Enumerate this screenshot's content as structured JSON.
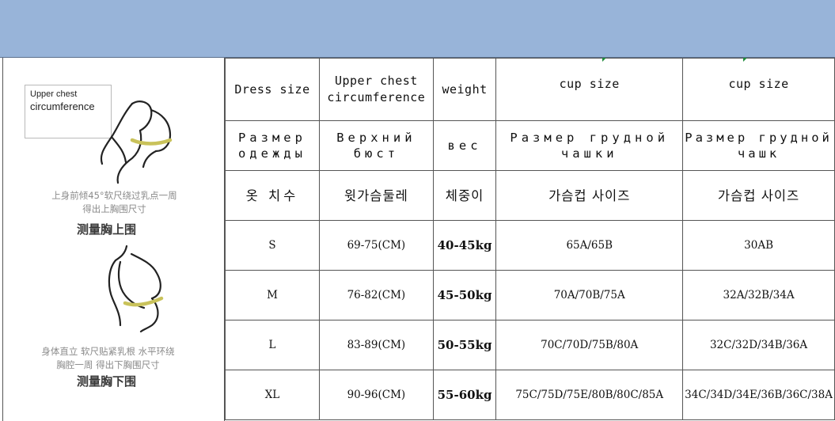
{
  "header_band": {
    "color": "#98b4d9"
  },
  "left_panel": {
    "callout": {
      "line1": "Upper chest",
      "line2": "circumference"
    },
    "upper_caption": {
      "line1": "上身前倾45°软尺绕过乳点一周",
      "line2": "得出上胸围尺寸",
      "title": "测量胸上围"
    },
    "lower_caption": {
      "line1": "身体直立 软尺贴紧乳根 水平环绕",
      "line2": "胸腔一周 得出下胸围尺寸",
      "title": "测量胸下围"
    },
    "tape_color": "#c9c25a"
  },
  "table": {
    "header_en": [
      "Dress size",
      "Upper chest circumference",
      "weight",
      "cup size",
      "cup size"
    ],
    "header_ru": [
      "Размер одежды",
      "Верхний бюст",
      "вес",
      "Размер грудной чашки",
      "Размер грудной чашк"
    ],
    "header_ko": [
      "옷 치수",
      "윗가슴둘레",
      "체중이",
      "가슴컵 사이즈",
      "가슴컵 사이즈"
    ],
    "rows": [
      {
        "size": "S",
        "upper_chest": "69-75(CM)",
        "weight": "40-45kg",
        "cup_a": "65A/65B",
        "cup_b": "30AB"
      },
      {
        "size": "M",
        "upper_chest": "76-82(CM)",
        "weight": "45-50kg",
        "cup_a": "70A/70B/75A",
        "cup_b": "32A/32B/34A"
      },
      {
        "size": "L",
        "upper_chest": "83-89(CM)",
        "weight": "50-55kg",
        "cup_a": "70C/70D/75B/80A",
        "cup_b": "32C/32D/34B/36A"
      },
      {
        "size": "XL",
        "upper_chest": "90-96(CM)",
        "weight": "55-60kg",
        "cup_a": "75C/75D/75E/80B/80C/85A",
        "cup_b": "34C/34D/34E/36B/36C/38A"
      }
    ]
  }
}
